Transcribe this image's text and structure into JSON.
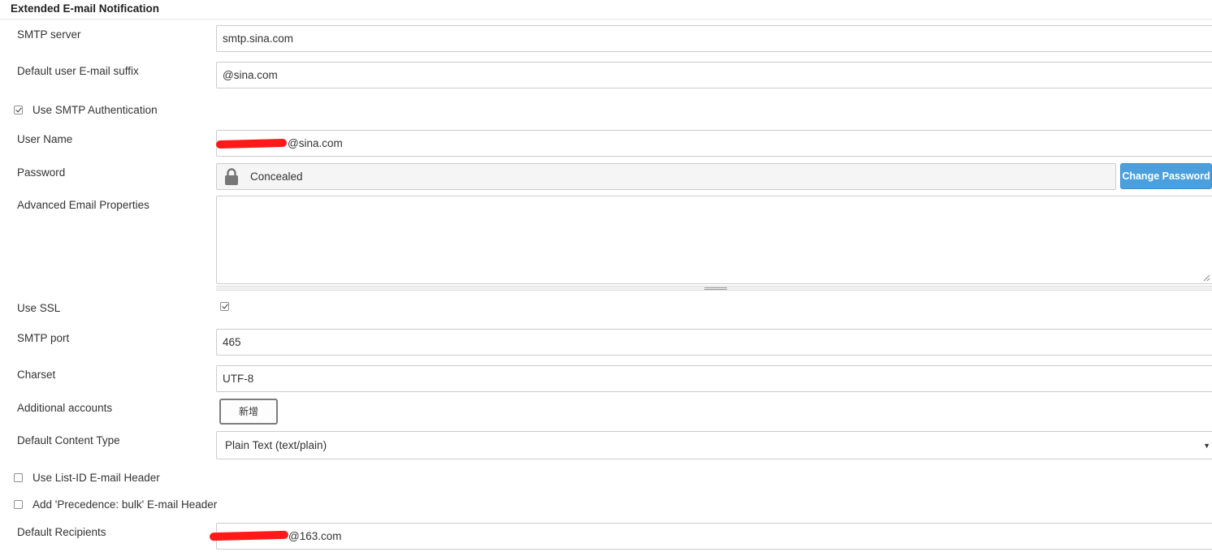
{
  "section": {
    "title": "Extended E-mail Notification"
  },
  "smtp_server": {
    "label": "SMTP server",
    "value": "smtp.sina.com"
  },
  "default_suffix": {
    "label": "Default user E-mail suffix",
    "value": "@sina.com"
  },
  "use_smtp_auth": {
    "label": "Use SMTP Authentication",
    "checked": true
  },
  "user_name": {
    "label": "User Name",
    "value_suffix": "@sina.com"
  },
  "password": {
    "label": "Password",
    "value": "Concealed",
    "change_button": "Change Password",
    "icon": "lock-icon"
  },
  "advanced_props": {
    "label": "Advanced Email Properties",
    "value": ""
  },
  "use_ssl": {
    "label": "Use SSL",
    "checked": true
  },
  "smtp_port": {
    "label": "SMTP port",
    "value": "465"
  },
  "charset": {
    "label": "Charset",
    "value": "UTF-8"
  },
  "additional_accounts": {
    "label": "Additional accounts",
    "add_button": "新增"
  },
  "content_type": {
    "label": "Default Content Type",
    "selected": "Plain Text (text/plain)"
  },
  "list_id_header": {
    "label": "Use List-ID E-mail Header",
    "checked": false
  },
  "precedence_header": {
    "label": "Add 'Precedence: bulk' E-mail Header",
    "checked": false
  },
  "default_recipients": {
    "label": "Default Recipients",
    "value_suffix": "@163.com"
  },
  "colors": {
    "accent_button": "#4b9fdc",
    "redaction": "#ff1a1a",
    "border": "#cccccc"
  }
}
